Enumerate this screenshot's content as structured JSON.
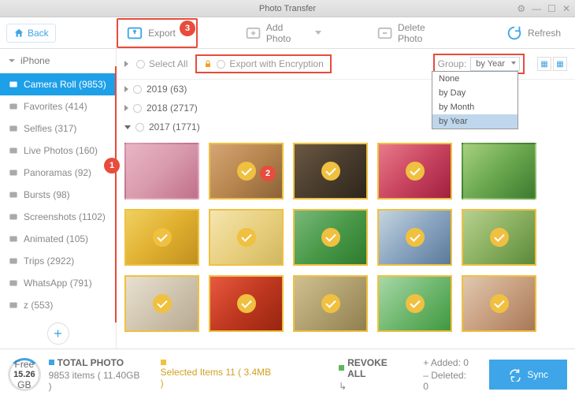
{
  "title": "Photo Transfer",
  "back": "Back",
  "toolbar": {
    "export": "Export",
    "add": "Add Photo",
    "delete": "Delete Photo",
    "refresh": "Refresh"
  },
  "device": "iPhone",
  "sidebar": [
    {
      "label": "Camera Roll (9853)",
      "icon": "camera",
      "active": true
    },
    {
      "label": "Favorites (414)",
      "icon": "heart"
    },
    {
      "label": "Selfies (317)",
      "icon": "person"
    },
    {
      "label": "Live Photos (160)",
      "icon": "live"
    },
    {
      "label": "Panoramas (92)",
      "icon": "pano"
    },
    {
      "label": "Bursts (98)",
      "icon": "burst"
    },
    {
      "label": "Screenshots (1102)",
      "icon": "screen"
    },
    {
      "label": "Animated (105)",
      "icon": "anim"
    },
    {
      "label": "Trips (2922)",
      "icon": "trips"
    },
    {
      "label": "WhatsApp (791)",
      "icon": "wa"
    },
    {
      "label": "z (553)",
      "icon": "user"
    }
  ],
  "filter": {
    "selectAll": "Select All",
    "encrypt": "Export with Encryption",
    "groupLabel": "Group:",
    "groupValue": "by Year"
  },
  "groupOptions": [
    "None",
    "by Day",
    "by Month",
    "by Year"
  ],
  "years": [
    {
      "label": "2019 (63)",
      "open": false
    },
    {
      "label": "2018 (2717)",
      "open": false
    },
    {
      "label": "2017 (1771)",
      "open": true
    }
  ],
  "footer": {
    "free": "Free",
    "size": "15.26",
    "unit": "GB",
    "totalLabel": "TOTAL PHOTO",
    "totalLine": "9853 items ( 11.40GB )",
    "selLine": "Selected Items 11 ( 3.4MB )",
    "revoke": "REVOKE ALL",
    "added": "Added: 0",
    "deleted": "Deleted: 0",
    "sync": "Sync"
  },
  "badges": {
    "b1": "1",
    "b2": "2",
    "b3": "3"
  }
}
